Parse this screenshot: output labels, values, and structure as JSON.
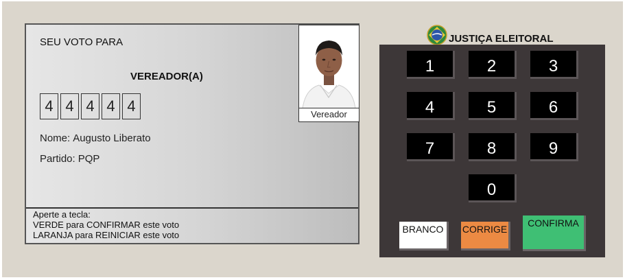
{
  "screen": {
    "heading": "SEU VOTO PARA",
    "office": "VEREADOR(A)",
    "digits": [
      "4",
      "4",
      "4",
      "4",
      "4"
    ],
    "name_label": "Nome:",
    "name_value": "Augusto Liberato",
    "party_label": "Partido:",
    "party_value": "PQP",
    "photo_caption": "Vereador",
    "instructions": {
      "line1": "Aperte a tecla:",
      "line2": "VERDE para CONFIRMAR este voto",
      "line3": "LARANJA para REINICIAR este voto"
    }
  },
  "header": {
    "title": "JUSTIÇA ELEITORAL"
  },
  "keypad": {
    "keys": [
      "1",
      "2",
      "3",
      "4",
      "5",
      "6",
      "7",
      "8",
      "9",
      "0"
    ],
    "branco": "BRANCO",
    "corrige": "CORRIGE",
    "confirma": "CONFIRMA"
  },
  "colors": {
    "panel": "#3d3738",
    "confirma": "#3fbf74",
    "corrige": "#ec8a43",
    "branco": "#ffffff"
  }
}
